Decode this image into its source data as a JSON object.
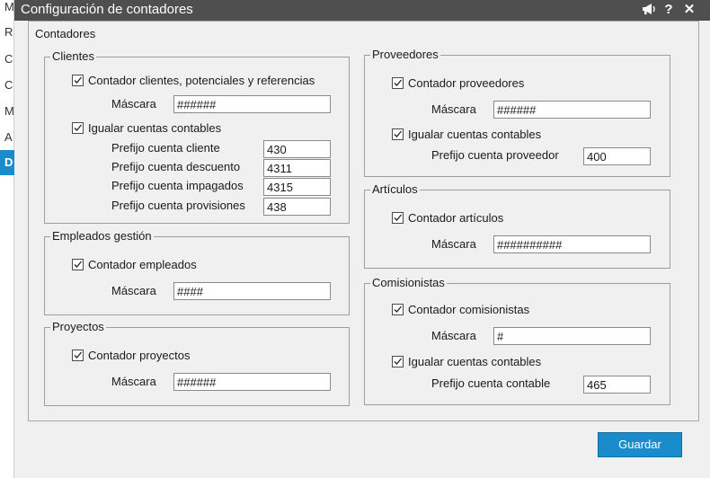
{
  "background_app": {
    "items": [
      "M",
      "R",
      "C",
      "C",
      "M",
      "A",
      "D"
    ]
  },
  "dialog": {
    "title": "Configuración de contadores",
    "icons": [
      "megaphone-icon",
      "help-icon",
      "close-icon"
    ],
    "help_glyph": "?",
    "close_glyph": "✕"
  },
  "contadores": {
    "legend": "Contadores",
    "clientes": {
      "legend": "Clientes",
      "contador_label": "Contador clientes, potenciales y referencias",
      "contador_checked": true,
      "mascara_label": "Máscara",
      "mascara_value": "######",
      "igualar_label": "Igualar cuentas contables",
      "igualar_checked": true,
      "prefijos": [
        {
          "label": "Prefijo cuenta cliente",
          "value": "430"
        },
        {
          "label": "Prefijo cuenta descuento",
          "value": "4311"
        },
        {
          "label": "Prefijo cuenta impagados",
          "value": "4315"
        },
        {
          "label": "Prefijo cuenta provisiones",
          "value": "438"
        }
      ]
    },
    "empleados": {
      "legend": "Empleados gestión",
      "contador_label": "Contador empleados",
      "contador_checked": true,
      "mascara_label": "Máscara",
      "mascara_value": "####"
    },
    "proyectos": {
      "legend": "Proyectos",
      "contador_label": "Contador proyectos",
      "contador_checked": true,
      "mascara_label": "Máscara",
      "mascara_value": "######"
    },
    "proveedores": {
      "legend": "Proveedores",
      "contador_label": "Contador proveedores",
      "contador_checked": true,
      "mascara_label": "Máscara",
      "mascara_value": "######",
      "igualar_label": "Igualar cuentas contables",
      "igualar_checked": true,
      "prefijo_label": "Prefijo cuenta proveedor",
      "prefijo_value": "400"
    },
    "articulos": {
      "legend": "Artículos",
      "contador_label": "Contador artículos",
      "contador_checked": true,
      "mascara_label": "Máscara",
      "mascara_value": "##########"
    },
    "comisionistas": {
      "legend": "Comisionistas",
      "contador_label": "Contador comisionistas",
      "contador_checked": true,
      "mascara_label": "Máscara",
      "mascara_value": "#",
      "igualar_label": "Igualar cuentas contables",
      "igualar_checked": true,
      "prefijo_label": "Prefijo cuenta contable",
      "prefijo_value": "465"
    }
  },
  "footer": {
    "save_label": "Guardar"
  }
}
